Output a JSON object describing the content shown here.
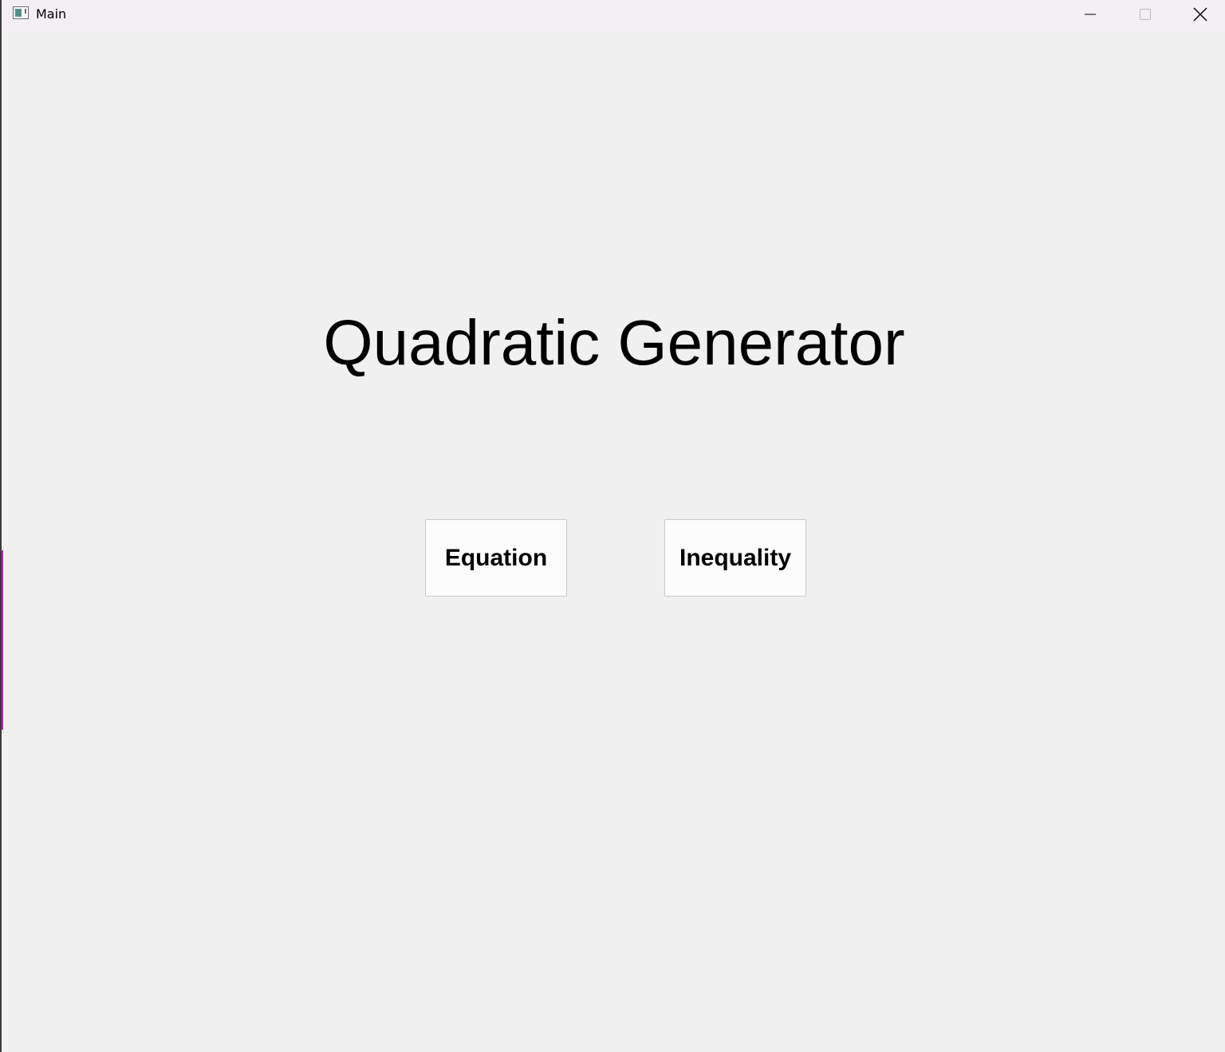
{
  "window": {
    "title": "Main",
    "controls": {
      "minimize_icon": "minimize-icon",
      "maximize_icon": "maximize-icon",
      "close_icon": "close-icon"
    }
  },
  "main": {
    "title": "Quadratic Generator",
    "buttons": [
      {
        "label": "Equation"
      },
      {
        "label": "Inequality"
      }
    ]
  },
  "colors": {
    "background": "#f0f0f0",
    "titlebar": "#f3eff5",
    "button_background": "#fdfcfd",
    "button_border": "#c9c9c9",
    "text": "#000000"
  }
}
